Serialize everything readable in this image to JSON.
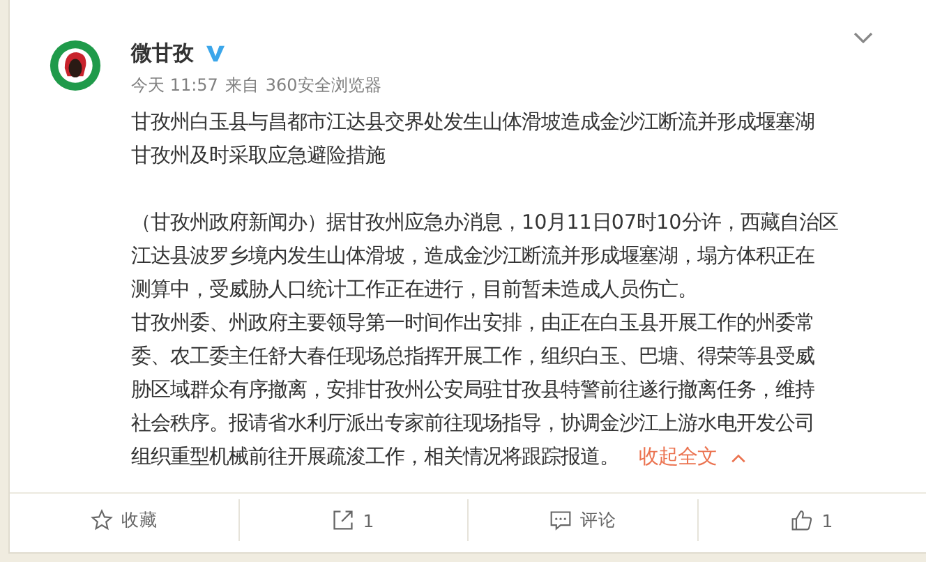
{
  "post": {
    "author": "微甘孜",
    "verified": true,
    "time": "今天 11:57",
    "source_prefix": "来自",
    "source": "360安全浏览器",
    "title_lines": [
      "甘孜州白玉县与昌都市江达县交界处发生山体滑坡造成金沙江断流并形成堰塞湖",
      "甘孜州及时采取应急避险措施"
    ],
    "paragraphs": [
      {
        "lines": [
          "（甘孜州政府新闻办）据甘孜州应急办消息，10月11日07时10分许，西藏自治区",
          "江达县波罗乡境内发生山体滑坡，造成金沙江断流并形成堰塞湖，塌方体积正在",
          "测算中，受威胁人口统计工作正在进行，目前暂未造成人员伤亡。"
        ]
      },
      {
        "lines": [
          "甘孜州委、州政府主要领导第一时间作出安排，由正在白玉县开展工作的州委常",
          "委、农工委主任舒大春任现场总指挥开展工作，组织白玉、巴塘、得荣等县受威",
          "胁区域群众有序撤离，安排甘孜州公安局驻甘孜县特警前往遂行撤离任务，维持",
          "社会秩序。报请省水利厅派出专家前往现场指导，协调金沙江上游水电开发公司",
          "组织重型机械前往开展疏浚工作，相关情况将跟踪报道。"
        ]
      }
    ],
    "collapse_link": "收起全文"
  },
  "actions": [
    {
      "kind": "favorite",
      "label": "收藏"
    },
    {
      "kind": "share",
      "label": "1"
    },
    {
      "kind": "comment",
      "label": "评论"
    },
    {
      "kind": "like",
      "label": "1"
    }
  ]
}
